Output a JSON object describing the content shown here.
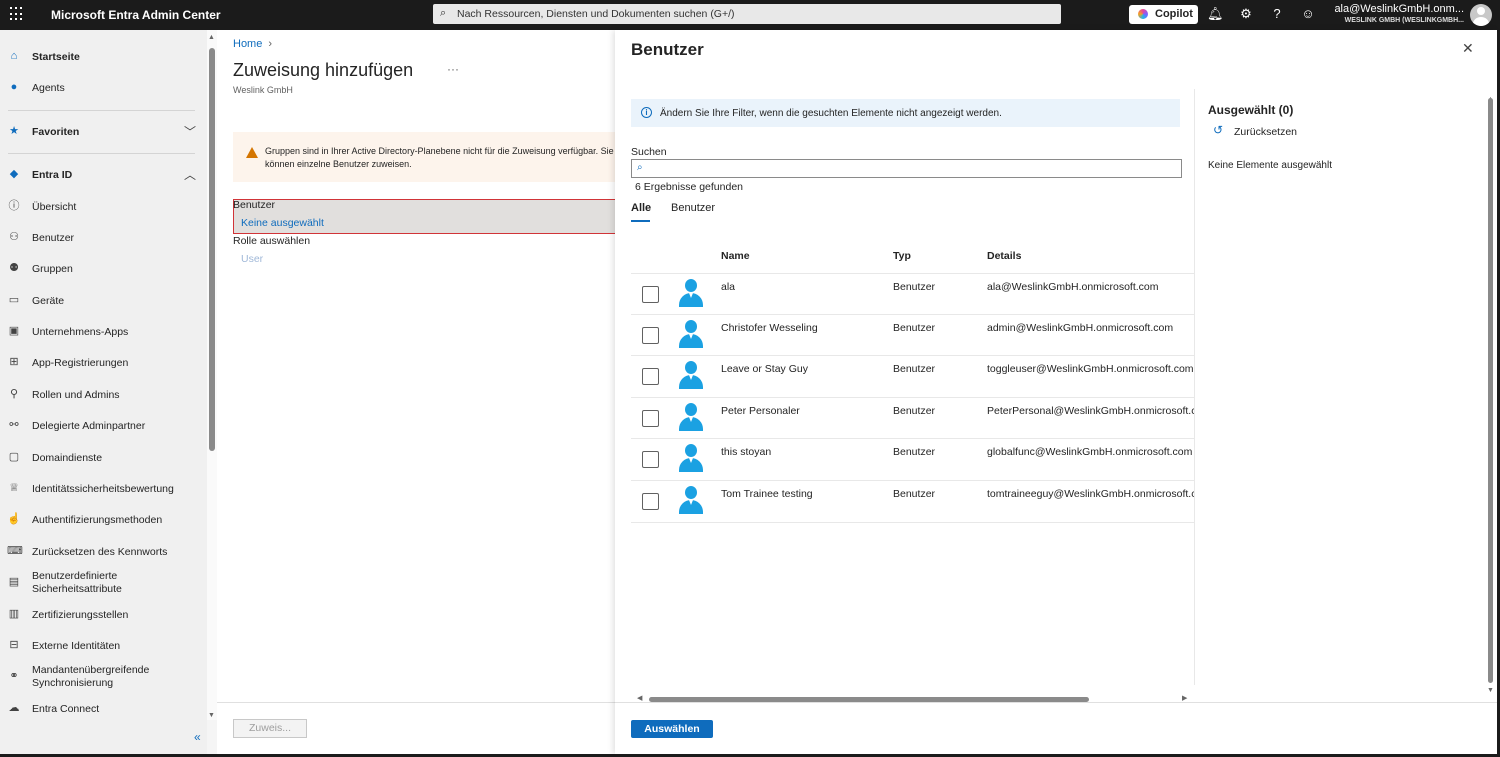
{
  "topbar": {
    "app_title": "Microsoft Entra Admin Center",
    "search_placeholder": "Nach Ressourcen, Diensten und Dokumenten suchen (G+/)",
    "copilot_label": "Copilot",
    "account_name": "ala@WeslinkGmbH.onm...",
    "account_org": "WESLINK GMBH (WESLINKGMBH..."
  },
  "sidebar": {
    "items": [
      {
        "label": "Startseite",
        "icon": "home-icon"
      },
      {
        "label": "Agents",
        "icon": "agents-icon"
      },
      {
        "label": "Favoriten",
        "icon": "star-icon"
      },
      {
        "label": "Entra ID",
        "icon": "entra-icon"
      },
      {
        "label": "Übersicht",
        "icon": "info-icon"
      },
      {
        "label": "Benutzer",
        "icon": "user-icon"
      },
      {
        "label": "Gruppen",
        "icon": "groups-icon"
      },
      {
        "label": "Geräte",
        "icon": "devices-icon"
      },
      {
        "label": "Unternehmens-Apps",
        "icon": "apps-icon"
      },
      {
        "label": "App-Registrierungen",
        "icon": "app-registrations-icon"
      },
      {
        "label": "Rollen und Admins",
        "icon": "roles-icon"
      },
      {
        "label": "Delegierte Adminpartner",
        "icon": "partners-icon"
      },
      {
        "label": "Domaindienste",
        "icon": "domain-icon"
      },
      {
        "label": "Identitätssicherheitsbewertung",
        "icon": "trophy-icon"
      },
      {
        "label": "Authentifizierungsmethoden",
        "icon": "auth-methods-icon"
      },
      {
        "label": "Zurücksetzen des Kennworts",
        "icon": "password-reset-icon"
      },
      {
        "label_line1": "Benutzerdefinierte",
        "label_line2": "Sicherheitsattribute",
        "icon": "security-attributes-icon"
      },
      {
        "label": "Zertifizierungsstellen",
        "icon": "certificate-icon"
      },
      {
        "label": "Externe Identitäten",
        "icon": "external-identities-icon"
      },
      {
        "label_line1": "Mandantenübergreifende",
        "label_line2": "Synchronisierung",
        "icon": "sync-icon"
      },
      {
        "label": "Entra Connect",
        "icon": "connect-icon"
      }
    ]
  },
  "main": {
    "breadcrumb_home": "Home",
    "title": "Zuweisung hinzufügen",
    "more": "···",
    "subtitle": "Weslink GmbH",
    "warning": "Gruppen sind in Ihrer Active Directory-Planebene nicht für die Zuweisung verfügbar. Sie können einzelne Benutzer zuweisen.",
    "users_label": "Benutzer",
    "users_value": "Keine ausgewählt",
    "role_label": "Rolle auswählen",
    "role_value": "User",
    "assign_button": "Zuweis..."
  },
  "panel": {
    "title": "Benutzer",
    "info": "Ändern Sie Ihre Filter, wenn die gesuchten Elemente nicht angezeigt werden.",
    "search_label": "Suchen",
    "search_value": "",
    "result_count": "6 Ergebnisse gefunden",
    "tabs": [
      "Alle",
      "Benutzer"
    ],
    "columns": [
      "Name",
      "Typ",
      "Details"
    ],
    "rows": [
      {
        "name": "ala",
        "type": "Benutzer",
        "details": "ala@WeslinkGmbH.onmicrosoft.com"
      },
      {
        "name": "Christofer Wesseling",
        "type": "Benutzer",
        "details": "admin@WeslinkGmbH.onmicrosoft.com"
      },
      {
        "name": "Leave or Stay Guy",
        "type": "Benutzer",
        "details": "toggleuser@WeslinkGmbH.onmicrosoft.com"
      },
      {
        "name": "Peter Personaler",
        "type": "Benutzer",
        "details": "PeterPersonal@WeslinkGmbH.onmicrosoft.com"
      },
      {
        "name": "this stoyan",
        "type": "Benutzer",
        "details": "globalfunc@WeslinkGmbH.onmicrosoft.com"
      },
      {
        "name": "Tom Trainee testing",
        "type": "Benutzer",
        "details": "tomtraineeguy@WeslinkGmbH.onmicrosoft.com"
      }
    ],
    "selected_title": "Ausgewählt (0)",
    "reset_label": "Zurücksetzen",
    "none_selected": "Keine Elemente ausgewählt",
    "select_button": "Auswählen"
  },
  "colors": {
    "accent": "#0f6cbd",
    "topbar": "#1b1b1b",
    "warning_bg": "#fdf4ec",
    "warning_icon": "#d47500",
    "info_bg": "#eaf3fb",
    "avatar": "#1ba1e2",
    "error_outline": "#d13438"
  }
}
